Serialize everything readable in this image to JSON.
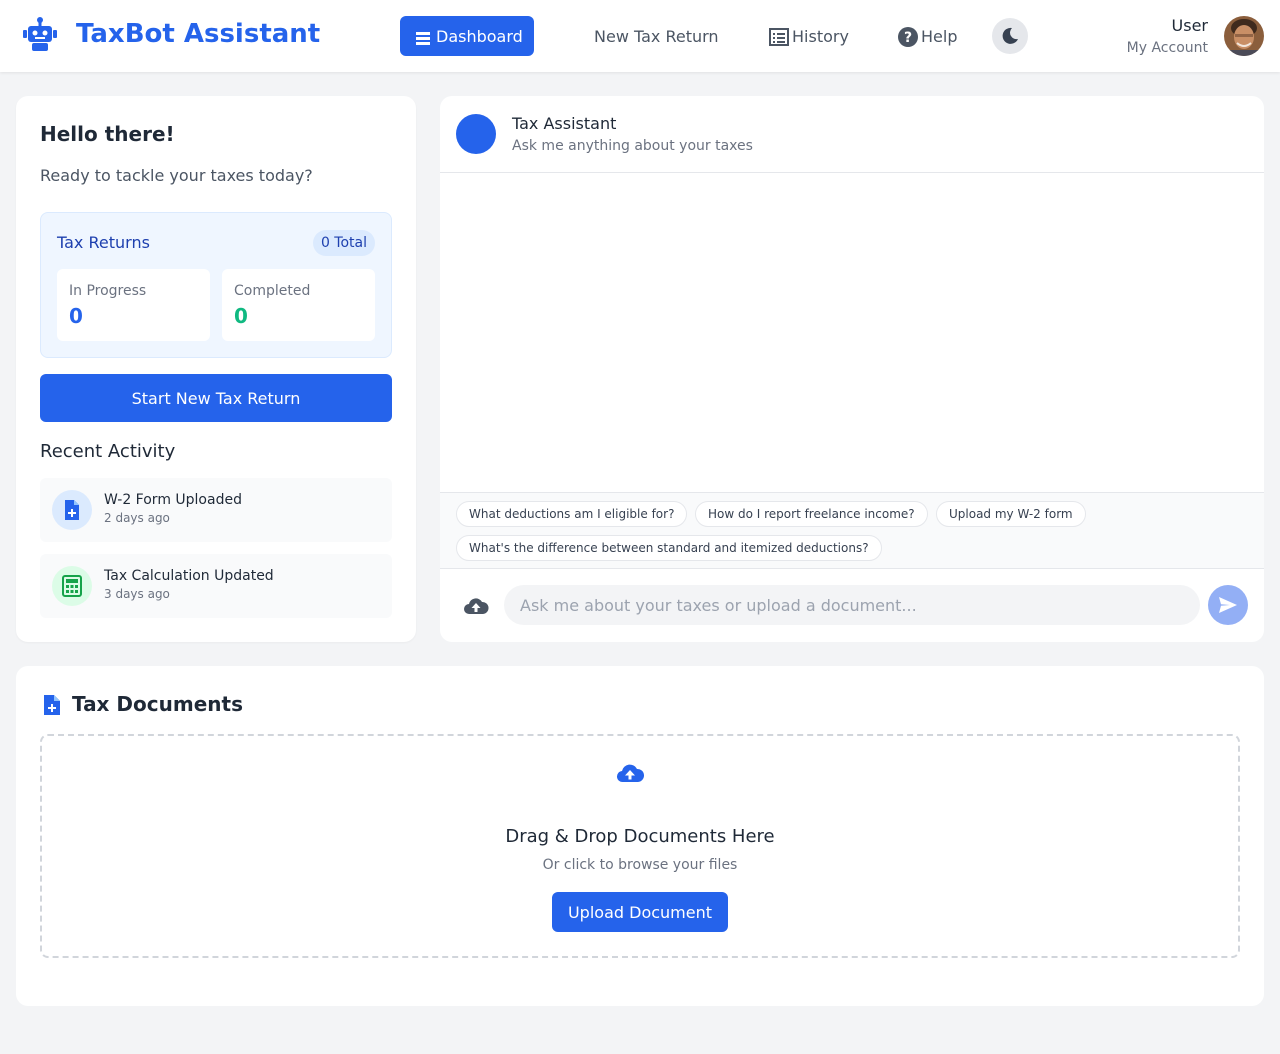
{
  "app": {
    "title": "TaxBot Assistant",
    "brand_color": "#2563eb"
  },
  "nav": {
    "items": [
      {
        "label": "Dashboard",
        "icon": "menu-icon",
        "active": true
      },
      {
        "label": "New Tax Return",
        "icon": "",
        "active": false
      },
      {
        "label": "History",
        "icon": "list-icon",
        "active": false
      },
      {
        "label": "Help",
        "icon": "help-circle-icon",
        "active": false
      }
    ],
    "theme_toggle_icon": "moon-icon"
  },
  "user": {
    "name": "User",
    "subtitle": "My Account"
  },
  "welcome": {
    "title": "Hello there!",
    "subtitle": "Ready to tackle your taxes today?"
  },
  "tax_returns": {
    "title": "Tax Returns",
    "total_badge": "0 Total",
    "stats": [
      {
        "label": "In Progress",
        "value": "0",
        "color": "#2563eb"
      },
      {
        "label": "Completed",
        "value": "0",
        "color": "#10b981"
      }
    ],
    "start_button": "Start New Tax Return"
  },
  "recent_activity": {
    "title": "Recent Activity",
    "items": [
      {
        "title": "W-2 Form Uploaded",
        "time": "2 days ago",
        "icon": "file-plus-icon"
      },
      {
        "title": "Tax Calculation Updated",
        "time": "3 days ago",
        "icon": "calculator-icon"
      }
    ]
  },
  "chat": {
    "title": "Tax Assistant",
    "subtitle": "Ask me anything about your taxes",
    "suggestions": [
      "What deductions am I eligible for?",
      "How do I report freelance income?",
      "Upload my W-2 form",
      "What's the difference between standard and itemized deductions?"
    ],
    "input_placeholder": "Ask me about your taxes or upload a document...",
    "upload_icon": "cloud-upload-icon",
    "send_icon": "send-icon"
  },
  "documents": {
    "title": "Tax Documents",
    "dropzone_title": "Drag & Drop Documents Here",
    "dropzone_subtitle": "Or click to browse your files",
    "upload_button": "Upload Document"
  }
}
